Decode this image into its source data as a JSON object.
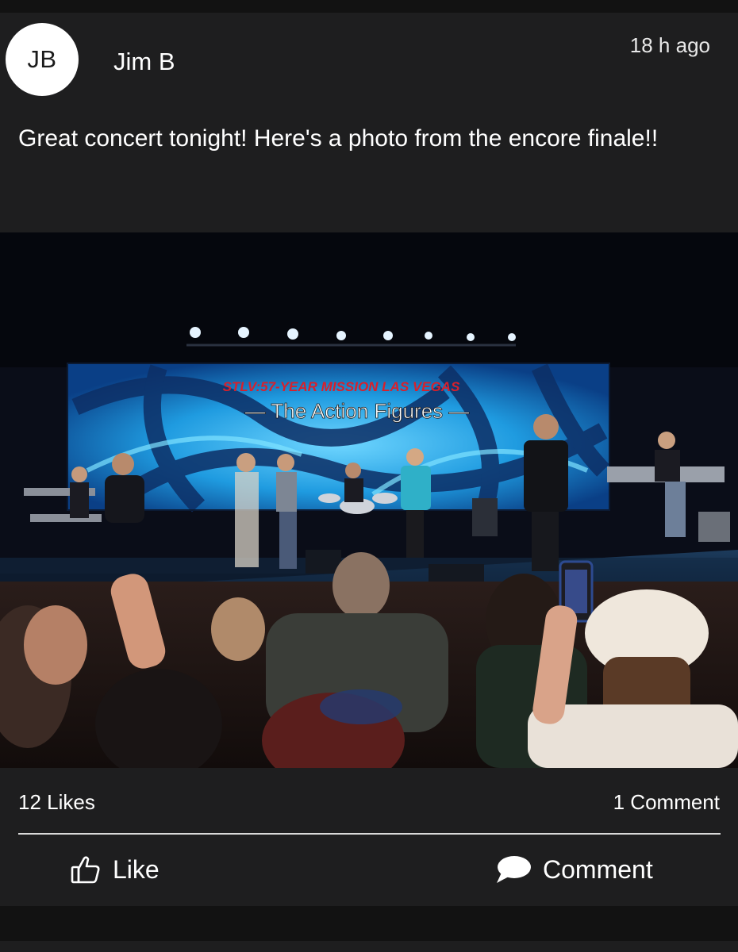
{
  "post": {
    "author": {
      "initials": "JB",
      "name": "Jim B"
    },
    "timestamp": "18 h ago",
    "text": "Great concert tonight!  Here's a photo from the encore finale!!",
    "photo": {
      "screen_line1": "STLV:57-YEAR MISSION LAS VEGAS",
      "screen_line2": "— The Action Figures —"
    },
    "stats": {
      "likes": "12 Likes",
      "comments": "1 Comment"
    },
    "actions": {
      "like_label": "Like",
      "like_icon": "thumbs-up-icon",
      "comment_label": "Comment",
      "comment_icon": "speech-bubble-icon"
    }
  },
  "colors": {
    "background": "#141414",
    "card": "#1e1e1f",
    "text": "#ffffff",
    "avatar_bg": "#ffffff",
    "divider": "#d9d9d9"
  }
}
